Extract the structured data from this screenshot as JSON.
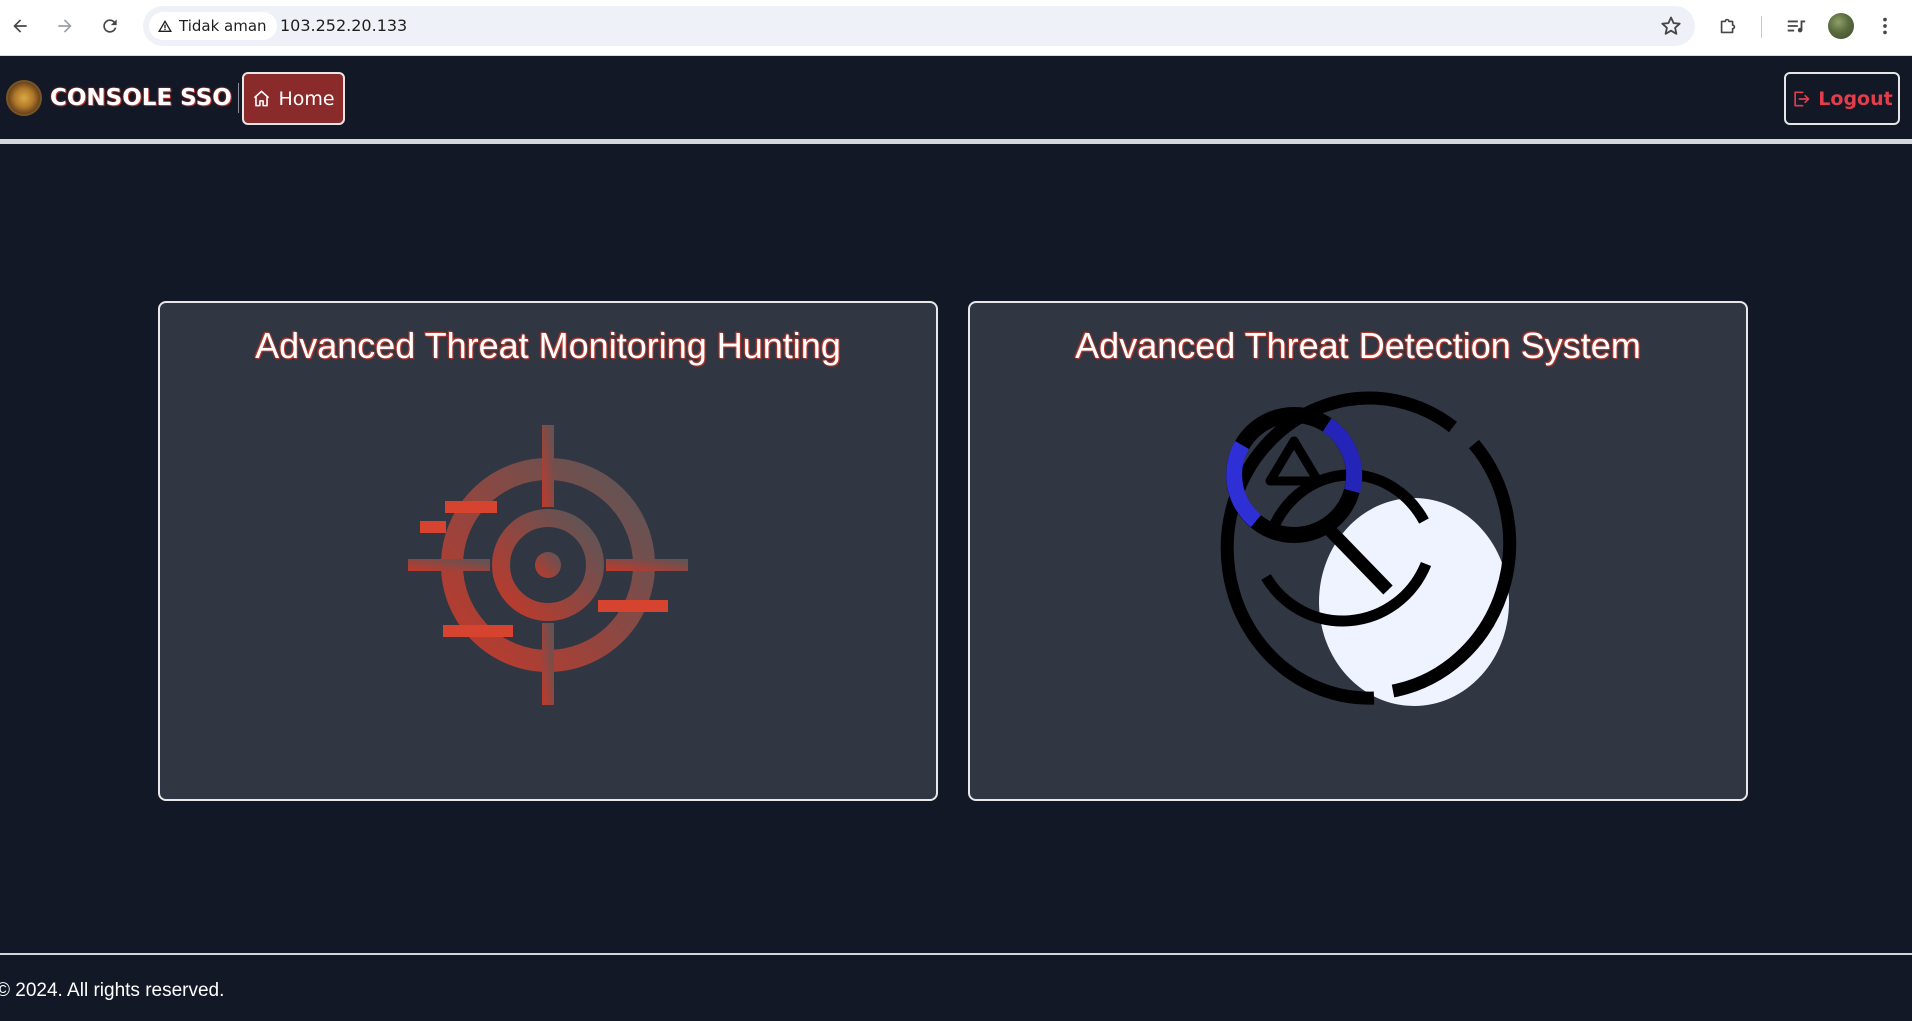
{
  "browser": {
    "security_label": "Tidak aman",
    "url": "103.252.20.133",
    "icons": {
      "back": "back-arrow-icon",
      "forward": "forward-arrow-icon",
      "reload": "reload-icon",
      "warning": "warning-triangle-icon",
      "bookmark": "star-icon",
      "extensions": "puzzle-icon",
      "media": "media-control-icon",
      "menu": "kebab-menu-icon"
    }
  },
  "header": {
    "brand_title": "CONSOLE SSO",
    "home_label": "Home",
    "logout_label": "Logout",
    "colors": {
      "background": "#131827",
      "home_button": "#8b2a2a",
      "logout_text": "#e23d4b"
    }
  },
  "cards": [
    {
      "title": "Advanced Threat Monitoring Hunting",
      "icon": "target-crosshair-icon"
    },
    {
      "title": "Advanced Threat Detection System",
      "icon": "magnifier-detection-icon"
    }
  ],
  "footer": {
    "copyright": "© 2024. All rights reserved."
  }
}
